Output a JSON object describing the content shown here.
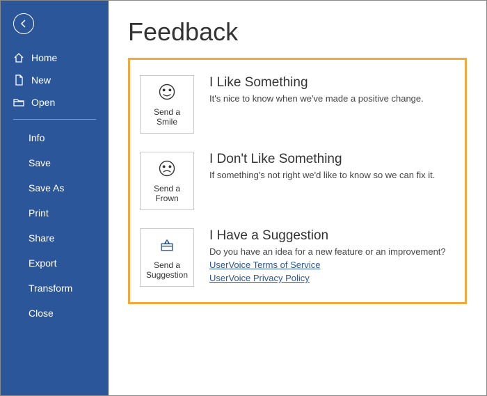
{
  "page_title": "Feedback",
  "sidebar": {
    "top": [
      {
        "label": "Home",
        "icon": "home-icon"
      },
      {
        "label": "New",
        "icon": "document-icon"
      },
      {
        "label": "Open",
        "icon": "folder-open-icon"
      }
    ],
    "bottom": [
      {
        "label": "Info"
      },
      {
        "label": "Save"
      },
      {
        "label": "Save As"
      },
      {
        "label": "Print"
      },
      {
        "label": "Share"
      },
      {
        "label": "Export"
      },
      {
        "label": "Transform"
      },
      {
        "label": "Close"
      }
    ]
  },
  "feedback": [
    {
      "tile_label": "Send a Smile",
      "title": "I Like Something",
      "desc": "It's nice to know when we've made a positive change."
    },
    {
      "tile_label": "Send a Frown",
      "title": "I Don't Like Something",
      "desc": "If something's not right we'd like to know so we can fix it."
    },
    {
      "tile_label": "Send a Suggestion",
      "title": "I Have a Suggestion",
      "desc": "Do you have an idea for a new feature or an improvement?",
      "links": [
        "UserVoice Terms of Service",
        "UserVoice Privacy Policy"
      ]
    }
  ]
}
